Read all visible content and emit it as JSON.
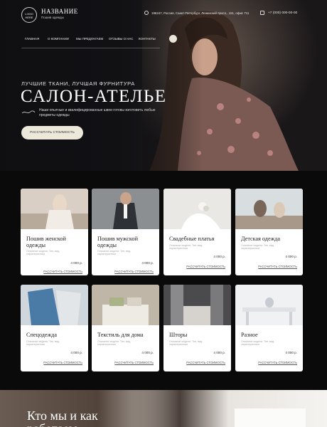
{
  "header": {
    "logo_text": "LOGO",
    "logo_sub": "HERE",
    "brand_name": "НАЗВАНИЕ",
    "brand_sub": "Пошив одежды",
    "address": "196247, Россия, Санкт-Петербург, Ленинский просп., 151, офис 711",
    "phone": "+7 (000) 000-00-00"
  },
  "nav": {
    "items": [
      "ГЛАВНАЯ",
      "О КОМПАНИИ",
      "МЫ ПРЕДЛАГАЕМ",
      "ОТЗЫВЫ О НАС",
      "КОНТАКТЫ"
    ]
  },
  "hero": {
    "tagline": "ЛУЧШИЕ ТКАНИ, ЛУЧШАЯ ФУРНИТУРА",
    "title": "САЛОН-АТЕЛЬЕ",
    "description": "Наши опытные и квалифицированные швеи готовы изготовить любые предметы одежды",
    "button": "РАССЧИТАТЬ СТОИМОСТЬ"
  },
  "services": [
    {
      "title": "Пошив женской одежды",
      "desc": "Описание модели. Тип, вид, характеристики",
      "price": "4 000 р.",
      "link": "РАССЧИТАТЬ СТОИМОСТЬ"
    },
    {
      "title": "Пошив мужской одежды",
      "desc": "Описание модели. Тип, вид, характеристики",
      "price": "4 000 р.",
      "link": "РАССЧИТАТЬ СТОИМОСТЬ"
    },
    {
      "title": "Свадебные платья",
      "desc": "Описание модели. Тип, вид, характеристики",
      "price": "4 000 р.",
      "link": "РАССЧИТАТЬ СТОИМОСТЬ"
    },
    {
      "title": "Детская одежда",
      "desc": "Описание модели. Тип, вид, характеристики",
      "price": "4 000 р.",
      "link": "РАССЧИТАТЬ СТОИМОСТЬ"
    },
    {
      "title": "Спецодежда",
      "desc": "Описание модели. Тип, вид, характеристики",
      "price": "4 000 р.",
      "link": "РАССЧИТАТЬ СТОИМОСТЬ"
    },
    {
      "title": "Текстиль для дома",
      "desc": "Описание модели. Тип, вид, характеристики",
      "price": "4 000 р.",
      "link": "РАССЧИТАТЬ СТОИМОСТЬ"
    },
    {
      "title": "Шторы",
      "desc": "Описание модели. Тип, вид, характеристики",
      "price": "4 000 р.",
      "link": "РАССЧИТАТЬ СТОИМОСТЬ"
    },
    {
      "title": "Разное",
      "desc": "Описание модели. Тип, вид, характеристики",
      "price": "4 000 р.",
      "link": "РАССЧИТАТЬ СТОИМОСТЬ"
    }
  ],
  "about": {
    "title_line1": "Кто мы и как",
    "title_line2": "работаем"
  },
  "colors": {
    "accent": "#ece8da",
    "dark_bg": "#0a0a0b",
    "card_bg": "#ffffff"
  }
}
